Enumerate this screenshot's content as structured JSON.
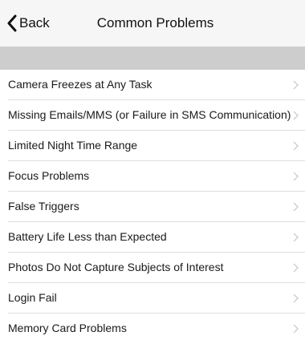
{
  "navbar": {
    "back_label": "Back",
    "title": "Common Problems"
  },
  "problems": {
    "items": [
      {
        "label": "Camera Freezes at Any Task"
      },
      {
        "label": "Missing Emails/MMS (or Failure in SMS Communication)"
      },
      {
        "label": "Limited Night Time Range"
      },
      {
        "label": "Focus Problems"
      },
      {
        "label": "False Triggers"
      },
      {
        "label": "Battery Life Less than Expected"
      },
      {
        "label": "Photos Do Not Capture Subjects of Interest"
      },
      {
        "label": "Login Fail"
      },
      {
        "label": "Memory Card Problems"
      }
    ]
  },
  "icons": {
    "back": "chevron-left-icon",
    "row_disclosure": "chevron-right-icon"
  },
  "colors": {
    "navbar_background": "#f6f6f6",
    "section_header": "#cdcdcd",
    "separator": "#dedede",
    "chevron": "#c4c4c9",
    "text": "#1a1a1a"
  }
}
